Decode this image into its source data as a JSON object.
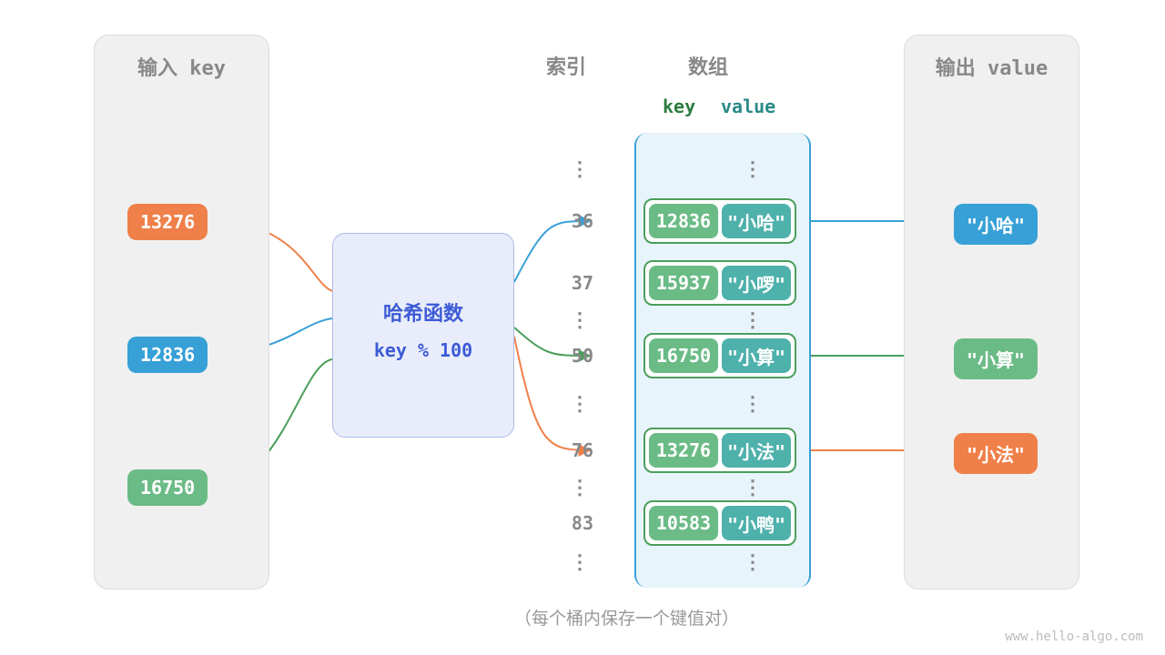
{
  "panels": {
    "input_title": "输入 key",
    "output_title": "输出 value"
  },
  "columns": {
    "index_title": "索引",
    "array_title": "数组",
    "key_sub": "key",
    "value_sub": "value"
  },
  "hash": {
    "title": "哈希函数",
    "formula": "key % 100"
  },
  "inputs": [
    {
      "key": "13276",
      "style": "orange"
    },
    {
      "key": "12836",
      "style": "blue"
    },
    {
      "key": "16750",
      "style": "green"
    }
  ],
  "indices": [
    "36",
    "37",
    "50",
    "76",
    "83"
  ],
  "buckets": [
    {
      "key": "12836",
      "value": "\"小哈\""
    },
    {
      "key": "15937",
      "value": "\"小啰\""
    },
    {
      "key": "16750",
      "value": "\"小算\""
    },
    {
      "key": "13276",
      "value": "\"小法\""
    },
    {
      "key": "10583",
      "value": "\"小鸭\""
    }
  ],
  "outputs": [
    {
      "value": "\"小哈\"",
      "style": "blue"
    },
    {
      "value": "\"小算\"",
      "style": "green"
    },
    {
      "value": "\"小法\"",
      "style": "orange"
    }
  ],
  "caption": "（每个桶内保存一个键值对）",
  "footer": "www.hello-algo.com"
}
